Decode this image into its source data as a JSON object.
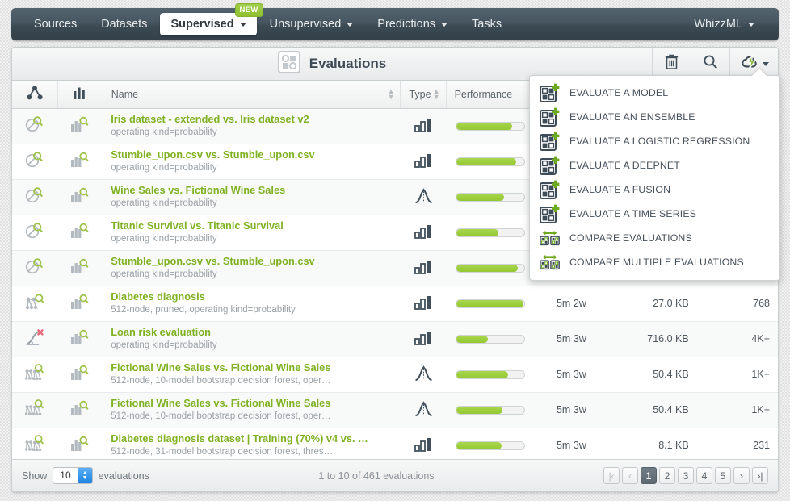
{
  "nav": {
    "items": [
      {
        "label": "Sources",
        "dropdown": false,
        "active": false,
        "badge": null
      },
      {
        "label": "Datasets",
        "dropdown": false,
        "active": false,
        "badge": null
      },
      {
        "label": "Supervised",
        "dropdown": true,
        "active": true,
        "badge": "NEW"
      },
      {
        "label": "Unsupervised",
        "dropdown": true,
        "active": false,
        "badge": null
      },
      {
        "label": "Predictions",
        "dropdown": true,
        "active": false,
        "badge": null
      },
      {
        "label": "Tasks",
        "dropdown": false,
        "active": false,
        "badge": null
      }
    ],
    "right": {
      "label": "WhizzML",
      "dropdown": true
    }
  },
  "toolbar": {
    "title": "Evaluations",
    "title_icon": "evaluations-grid-icon",
    "actions": [
      {
        "name": "delete-button",
        "icon": "trash-icon"
      },
      {
        "name": "search-button",
        "icon": "search-icon"
      },
      {
        "name": "create-evaluation-button",
        "icon": "cloud-lightning-icon"
      }
    ]
  },
  "table": {
    "headers": {
      "resource_icon": "model-icon",
      "chart_icon": "histogram-icon",
      "name": "Name",
      "type": "Type",
      "performance": "Performance",
      "age": "",
      "size": "",
      "instances": ""
    },
    "rows": [
      {
        "resource_icon": "model-search-icon",
        "chart_icon": "histogram-search-icon",
        "name": "Iris dataset - extended vs. Iris dataset v2",
        "subtitle": "operating kind=probability",
        "type_icon": "classification-icon",
        "performance": 82,
        "age": "",
        "size": "",
        "instances": ""
      },
      {
        "resource_icon": "model-search-icon",
        "chart_icon": "histogram-search-icon",
        "name": "Stumble_upon.csv vs. Stumble_upon.csv",
        "subtitle": "operating kind=probability",
        "type_icon": "classification-icon",
        "performance": 88,
        "age": "",
        "size": "",
        "instances": ""
      },
      {
        "resource_icon": "model-search-icon",
        "chart_icon": "histogram-search-icon",
        "name": "Wine Sales vs. Fictional Wine Sales",
        "subtitle": "operating kind=probability",
        "type_icon": "regression-icon",
        "performance": 70,
        "age": "",
        "size": "",
        "instances": ""
      },
      {
        "resource_icon": "model-search-icon",
        "chart_icon": "histogram-search-icon",
        "name": "Titanic Survival vs. Titanic Survival",
        "subtitle": "operating kind=probability",
        "type_icon": "classification-icon",
        "performance": 62,
        "age": "",
        "size": "",
        "instances": ""
      },
      {
        "resource_icon": "model-search-icon",
        "chart_icon": "histogram-search-icon",
        "name": "Stumble_upon.csv vs. Stumble_upon.csv",
        "subtitle": "operating kind=probability",
        "type_icon": "classification-icon",
        "performance": 90,
        "age": "",
        "size": "",
        "instances": ""
      },
      {
        "resource_icon": "decision-tree-search-icon",
        "chart_icon": "histogram-search-icon",
        "name": "Diabetes diagnosis",
        "subtitle": "512-node, pruned, operating kind=probability",
        "type_icon": "classification-icon",
        "performance": 98,
        "age": "5m 2w",
        "size": "27.0 KB",
        "instances": "768"
      },
      {
        "resource_icon": "logistic-regression-error-icon",
        "chart_icon": "histogram-search-icon",
        "name": "Loan risk evaluation",
        "subtitle": "operating kind=probability",
        "type_icon": "classification-icon",
        "performance": 46,
        "age": "5m 3w",
        "size": "716.0 KB",
        "instances": "4K+"
      },
      {
        "resource_icon": "ensemble-search-icon",
        "chart_icon": "histogram-search-icon",
        "name": "Fictional Wine Sales vs. Fictional Wine Sales",
        "subtitle": "512-node, 10-model bootstrap decision forest, oper…",
        "type_icon": "regression-icon",
        "performance": 76,
        "age": "5m 3w",
        "size": "50.4 KB",
        "instances": "1K+"
      },
      {
        "resource_icon": "ensemble-search-icon",
        "chart_icon": "histogram-search-icon",
        "name": "Fictional Wine Sales vs. Fictional Wine Sales",
        "subtitle": "512-node, 10-model bootstrap decision forest, oper…",
        "type_icon": "regression-icon",
        "performance": 68,
        "age": "5m 3w",
        "size": "50.4 KB",
        "instances": "1K+"
      },
      {
        "resource_icon": "ensemble-search-icon",
        "chart_icon": "histogram-search-icon",
        "name": "Diabetes diagnosis dataset | Training (70%) v4 vs. …",
        "subtitle": "512-node, 31-model bootstrap decision forest, thres…",
        "type_icon": "classification-icon",
        "performance": 66,
        "age": "5m 3w",
        "size": "8.1 KB",
        "instances": "231"
      }
    ]
  },
  "menu": {
    "items": [
      {
        "label": "EVALUATE A MODEL",
        "icon": "evaluate-add-icon"
      },
      {
        "label": "EVALUATE AN ENSEMBLE",
        "icon": "evaluate-add-icon"
      },
      {
        "label": "EVALUATE A LOGISTIC REGRESSION",
        "icon": "evaluate-add-icon"
      },
      {
        "label": "EVALUATE A DEEPNET",
        "icon": "evaluate-add-icon"
      },
      {
        "label": "EVALUATE A FUSION",
        "icon": "evaluate-add-icon"
      },
      {
        "label": "EVALUATE A TIME SERIES",
        "icon": "evaluate-add-icon"
      },
      {
        "label": "COMPARE EVALUATIONS",
        "icon": "compare-icon"
      },
      {
        "label": "COMPARE MULTIPLE EVALUATIONS",
        "icon": "compare-icon"
      }
    ]
  },
  "footer": {
    "show_label": "Show",
    "page_size": "10",
    "unit_label": "evaluations",
    "count_text": "1 to 10 of 461 evaluations",
    "pages": [
      "1",
      "2",
      "3",
      "4",
      "5"
    ],
    "active_page": "1",
    "first_label": "|‹",
    "prev_label": "‹",
    "next_label": "›",
    "last_label": "›|"
  },
  "colors": {
    "accent_green": "#94c832",
    "name_green": "#7fb122",
    "navbar_dark": "#46555f",
    "text_dark": "#3e4b55"
  }
}
